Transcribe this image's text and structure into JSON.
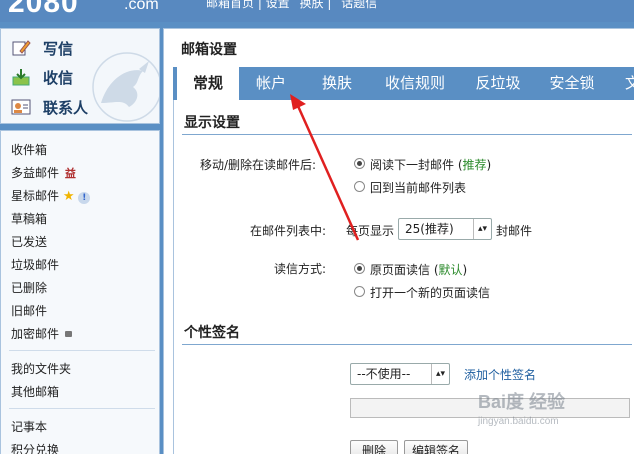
{
  "brand": {
    "logo_text": "2080",
    "logo_suffix": ".com"
  },
  "top_links": [
    "邮箱首页 | 设置",
    "换肤 |",
    "话题信"
  ],
  "compose": {
    "items": [
      {
        "label": "写信",
        "icon": "pencil-note-icon"
      },
      {
        "label": "收信",
        "icon": "inbox-download-icon"
      },
      {
        "label": "联系人",
        "icon": "contact-card-icon"
      }
    ]
  },
  "folders": [
    {
      "label": "收件箱"
    },
    {
      "label": "多益邮件",
      "badge_icon": "multi-gift-icon"
    },
    {
      "label": "星标邮件",
      "badge_icon": "star-info-icon"
    },
    {
      "label": "草稿箱"
    },
    {
      "label": "已发送"
    },
    {
      "label": "垃圾邮件"
    },
    {
      "label": "已删除"
    },
    {
      "label": "旧邮件"
    },
    {
      "label": "加密邮件",
      "badge_icon": "lock-icon"
    }
  ],
  "my_folders": [
    {
      "label": "我的文件夹"
    },
    {
      "label": "其他邮箱"
    }
  ],
  "tools": [
    {
      "label": "记事本"
    },
    {
      "label": "积分兑换"
    }
  ],
  "main": {
    "title": "邮箱设置",
    "tabs": [
      {
        "label": "常规",
        "active": true
      },
      {
        "label": "帐户",
        "active": false
      },
      {
        "label": "换肤",
        "active": false
      },
      {
        "label": "收信规则",
        "active": false
      },
      {
        "label": "反垃圾",
        "active": false
      },
      {
        "label": "安全锁",
        "active": false
      },
      {
        "label": "文",
        "active": false
      }
    ]
  },
  "display_settings": {
    "title": "显示设置",
    "after_move_label": "移动/删除在读邮件后:",
    "after_move_options": [
      {
        "label": "阅读下一封邮件 (",
        "extra": "推荐",
        "tail": ")",
        "selected": true
      },
      {
        "label": "回到当前邮件列表",
        "selected": false
      }
    ],
    "per_page_label": "在邮件列表中:",
    "per_page_prefix": "每页显示",
    "per_page_value": "25(推荐)",
    "per_page_suffix": "封邮件",
    "read_mode_label": "读信方式:",
    "read_mode_options": [
      {
        "label": "原页面读信 (",
        "extra": "默认",
        "tail": ")",
        "selected": true
      },
      {
        "label": "打开一个新的页面读信",
        "selected": false
      }
    ]
  },
  "signature": {
    "title": "个性签名",
    "select_value": "--不使用--",
    "add_link": "添加个性签名",
    "delete_button": "删除",
    "edit_button": "编辑签名"
  },
  "watermark": {
    "text": "Bai度 经验",
    "url_text": "jingyan.baidu.com"
  },
  "annotation": {
    "arrow_color": "#e02020"
  }
}
